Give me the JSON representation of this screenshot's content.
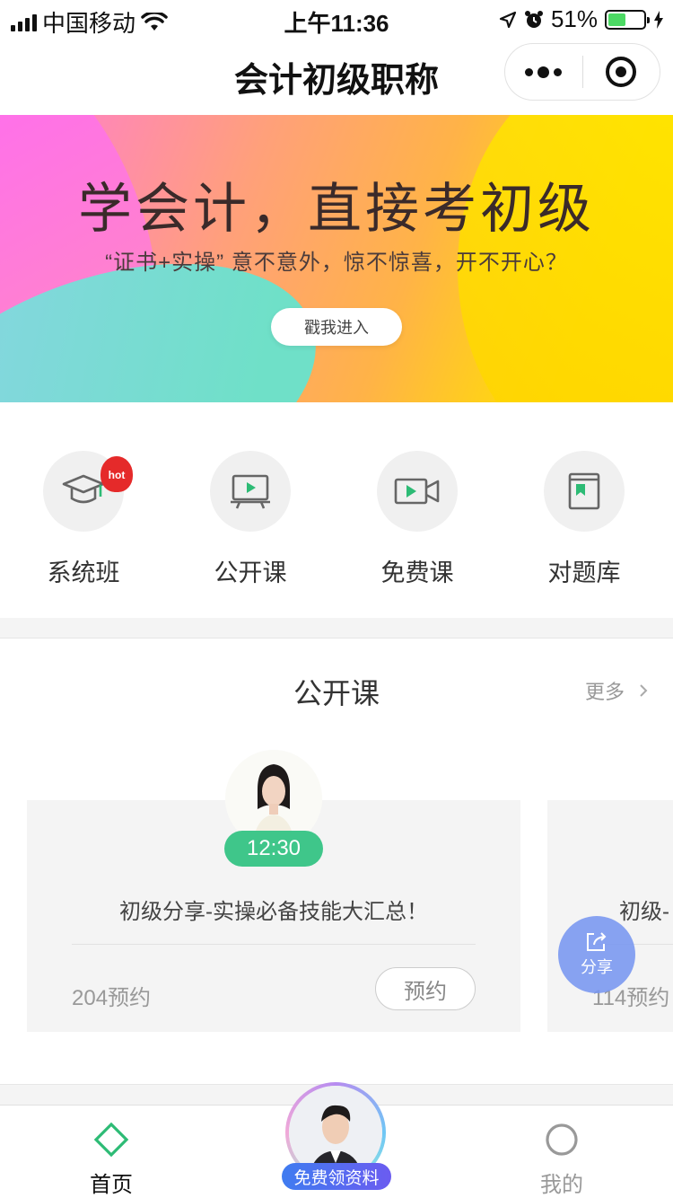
{
  "status_bar": {
    "carrier": "中国移动",
    "time": "上午11:36",
    "battery_percent": "51%",
    "battery_level": 0.51,
    "icons": [
      "signal-icon",
      "wifi-icon",
      "location-icon",
      "alarm-icon",
      "battery-icon",
      "charging-icon"
    ]
  },
  "nav": {
    "title": "会计初级职称",
    "icons": [
      "more-dots-icon",
      "close-circle-icon"
    ]
  },
  "banner": {
    "headline": "学会计，直接考初级",
    "subtitle": "“证书+实操”  意不意外，惊不惊喜，开不开心？",
    "button_label": "戳我进入"
  },
  "categories": [
    {
      "label": "系统班",
      "icon": "graduation-cap-icon",
      "badge": "hot"
    },
    {
      "label": "公开课",
      "icon": "screen-play-icon"
    },
    {
      "label": "免费课",
      "icon": "video-camera-icon"
    },
    {
      "label": "对题库",
      "icon": "book-icon"
    }
  ],
  "section": {
    "title": "公开课",
    "more_label": "更多",
    "cards": [
      {
        "time": "12:30",
        "title": "初级分享-实操必备技能大汇总！",
        "count": "204预约",
        "button": "预约"
      },
      {
        "title": "初级-",
        "count": "114预约"
      }
    ]
  },
  "share_fab": {
    "label": "分享"
  },
  "tabbar": {
    "home_label": "首页",
    "promo_label": "免费领资料",
    "mine_label": "我的"
  },
  "colors": {
    "accent_green": "#3fc68a",
    "share_blue": "#7896f0",
    "promo_blue": "#3f7cf0"
  }
}
